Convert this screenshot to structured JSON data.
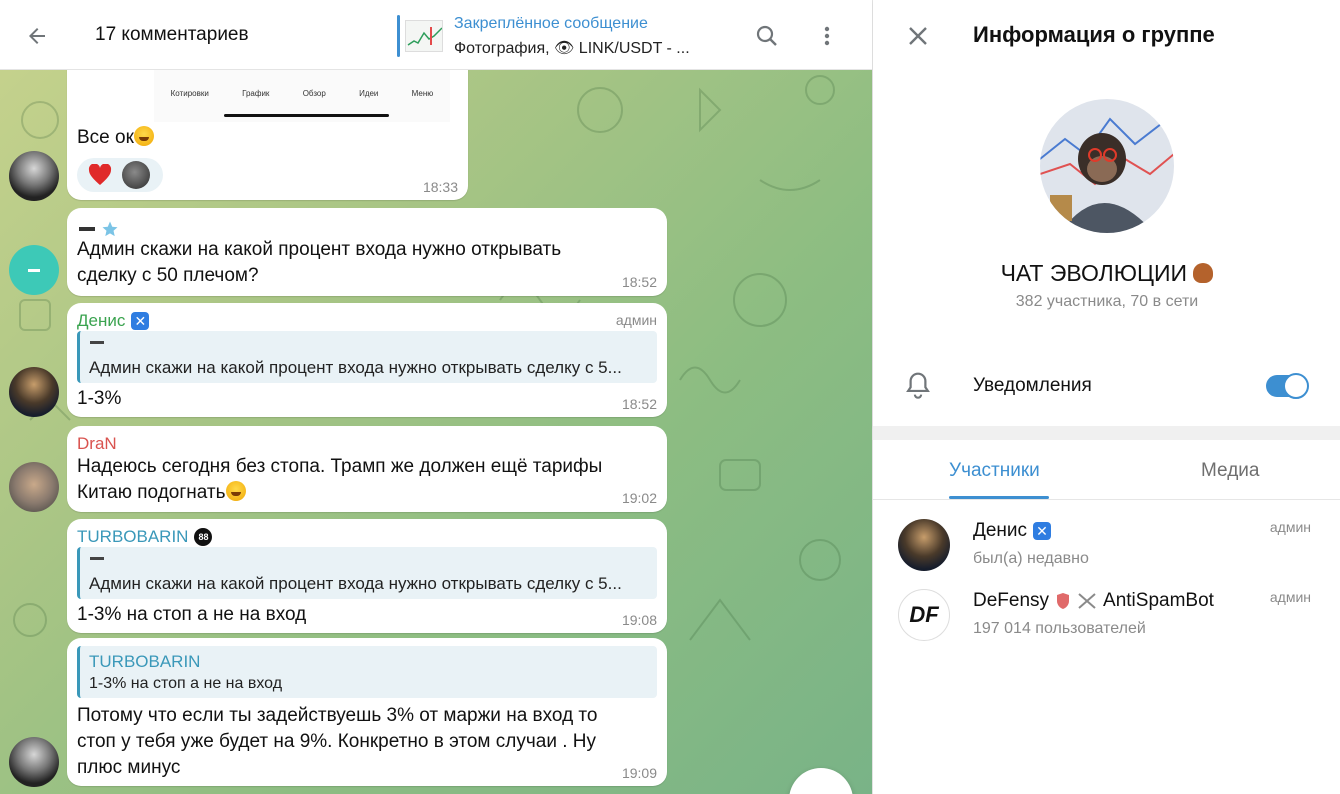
{
  "chat_header": {
    "title": "17 комментариев",
    "pinned_title": "Закреплённое сообщение",
    "pinned_sub": "Фотография, 👁 LINK/USDT - ..."
  },
  "first_message": {
    "nav_items": [
      "Котировки",
      "График",
      "Обзор",
      "Идеи",
      "Меню"
    ],
    "text": "Все ок",
    "reactions": [
      "heart",
      "avatar"
    ],
    "time": "18:33"
  },
  "messages": [
    {
      "sender_mark": "▬ ★",
      "lines": [
        "Админ скажи на какой процент входа нужно открывать",
        "сделку с 50 плечом?"
      ],
      "time": "18:52"
    },
    {
      "sender": "Денис",
      "sender_color": "#3aa34f",
      "badge": "✕",
      "role": "админ",
      "quote_text": "Админ скажи на какой процент входа нужно открывать сделку с 5...",
      "lines": [
        "1-3%"
      ],
      "time": "18:52"
    },
    {
      "sender": "DraN",
      "sender_color": "#d9534f",
      "lines": [
        "Надеюсь сегодня без стопа. Трамп же должен ещё тарифы",
        "Китаю подогнать"
      ],
      "time": "19:02"
    },
    {
      "sender": "TURBOBARIN",
      "sender_color": "#3a98b9",
      "badge": "88",
      "quote_text": "Админ скажи на какой процент входа нужно открывать сделку с 5...",
      "lines": [
        "1-3% на стоп а не на вход"
      ],
      "time": "19:08"
    },
    {
      "quote_sender": "TURBOBARIN",
      "quote_text": "1-3% на стоп а не на вход",
      "lines": [
        "Потому что если ты задействуешь 3% от маржи на вход то",
        "стоп у тебя уже будет на 9%. Конкретно в этом случаи . Ну",
        "плюс минус"
      ],
      "time": "19:09"
    }
  ],
  "info_panel": {
    "title": "Информация о группе",
    "group_name": "ЧАТ ЭВОЛЮЦИИ",
    "group_meta": "382 участника, 70 в сети",
    "notifications_label": "Уведомления",
    "notifications_on": true,
    "tabs": [
      "Участники",
      "Медиа"
    ],
    "members": [
      {
        "name": "Денис",
        "status": "был(а) недавно",
        "role": "админ"
      },
      {
        "name": "DeFensy",
        "bot_name": "AntiSpamBot",
        "status": "197 014 пользователей",
        "role": "админ",
        "avatar_text": "DF"
      }
    ]
  },
  "colors": {
    "accent": "#3d8fd1",
    "toggle": "#3d8fd1",
    "admin_green": "#3aa34f",
    "dran_red": "#d9534f",
    "turbo_teal": "#3a98b9"
  },
  "icons": [
    "back-arrow-icon",
    "search-icon",
    "more-vert-icon",
    "eye-icon",
    "close-icon",
    "bell-icon",
    "heart-icon",
    "star-icon"
  ]
}
